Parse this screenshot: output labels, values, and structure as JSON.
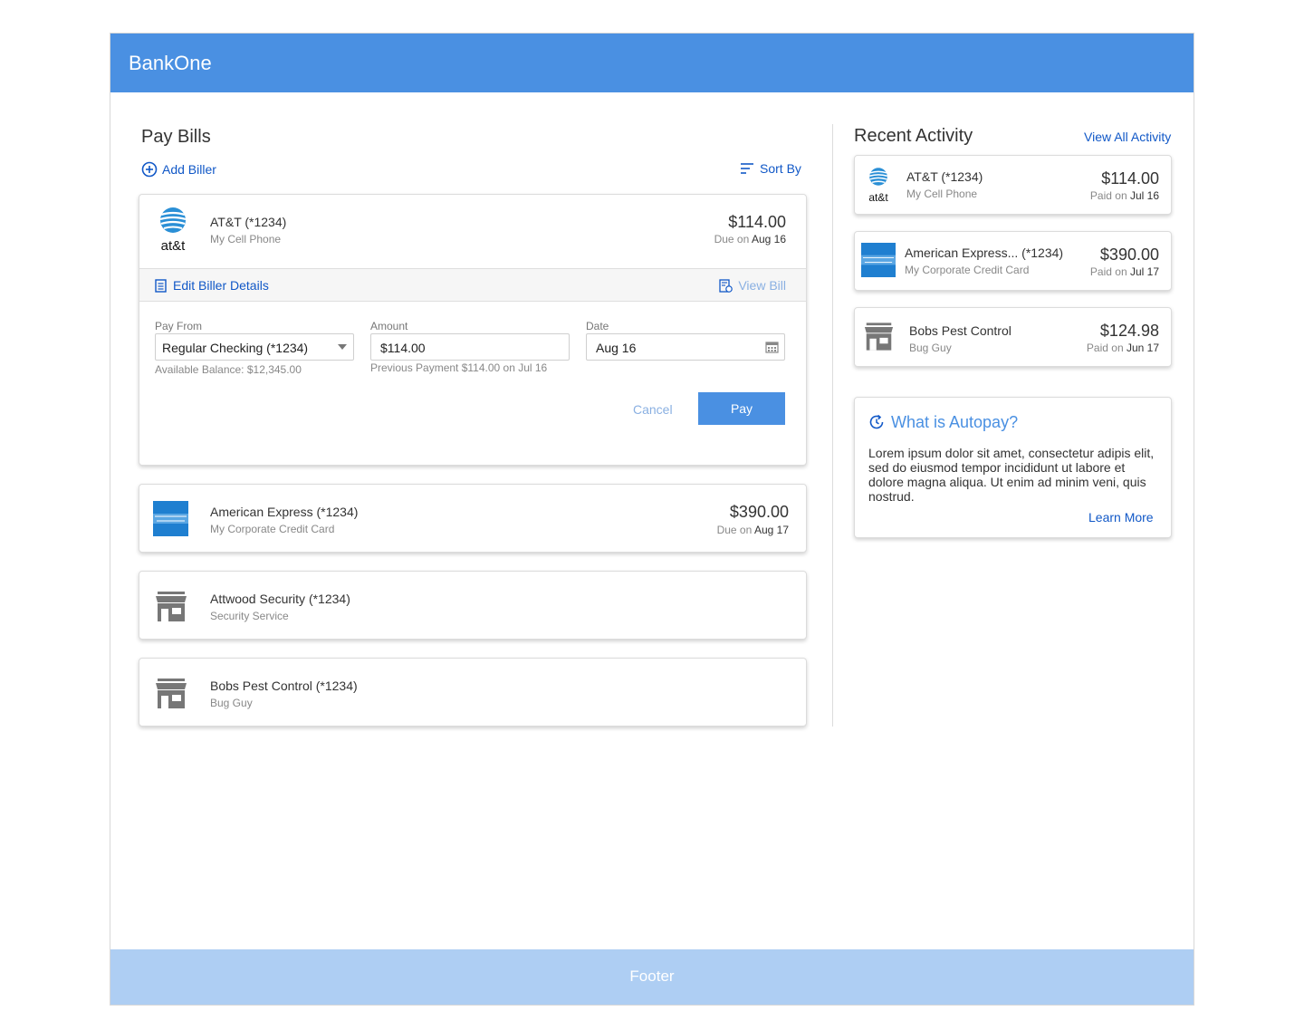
{
  "app": {
    "brand": "BankOne"
  },
  "pay_bills": {
    "title": "Pay Bills",
    "add_biller": "Add Biller",
    "sort_by": "Sort By",
    "billers": [
      {
        "name": "AT&T (*1234)",
        "subtitle": "My Cell Phone",
        "amount": "$114.00",
        "due_prefix": "Due on",
        "due_date": "Aug 16",
        "logo": "att-logo"
      },
      {
        "name": "American Express (*1234)",
        "subtitle": "My Corporate Credit Card",
        "amount": "$390.00",
        "due_prefix": "Due on",
        "due_date": "Aug 17",
        "logo": "amex-logo"
      },
      {
        "name": "Attwood Security (*1234)",
        "subtitle": "Security Service",
        "logo": "store-icon"
      },
      {
        "name": "Bobs Pest Control (*1234)",
        "subtitle": "Bug Guy",
        "logo": "store-icon"
      }
    ],
    "expanded": {
      "att_logo_text": "at&t",
      "edit_biller": "Edit Biller Details",
      "view_bill": "View Bill",
      "pay_from_label": "Pay From",
      "pay_from_value": "Regular Checking (*1234)",
      "available_balance": "Available Balance: $12,345.00",
      "amount_label": "Amount",
      "amount_value": "$114.00",
      "previous_payment": "Previous Payment $114.00 on Jul 16",
      "date_label": "Date",
      "date_value": "Aug 16",
      "cancel": "Cancel",
      "pay": "Pay"
    }
  },
  "recent_activity": {
    "title": "Recent Activity",
    "view_all": "View All Activity",
    "items": [
      {
        "name": "AT&T (*1234)",
        "subtitle": "My Cell Phone",
        "amount": "$114.00",
        "paid_prefix": "Paid on",
        "paid_date": "Jul 16",
        "logo": "att-logo"
      },
      {
        "name": "American Express... (*1234)",
        "subtitle": "My Corporate Credit Card",
        "amount": "$390.00",
        "paid_prefix": "Paid on",
        "paid_date": "Jul 17",
        "logo": "amex-logo"
      },
      {
        "name": "Bobs Pest Control",
        "subtitle": "Bug Guy",
        "amount": "$124.98",
        "paid_prefix": "Paid on",
        "paid_date": "Jun 17",
        "logo": "store-icon"
      }
    ]
  },
  "autopay": {
    "title": "What is Autopay?",
    "body": "Lorem ipsum dolor sit amet, consectetur adipis elit, sed do eiusmod tempor incididunt ut labore et dolore magna aliqua. Ut enim ad minim veni, quis nostrud.",
    "learn_more": "Learn More"
  },
  "footer": {
    "label": "Footer"
  },
  "colors": {
    "brand": "#4a90e2",
    "link": "#1158c7",
    "footer": "#aecef3"
  }
}
